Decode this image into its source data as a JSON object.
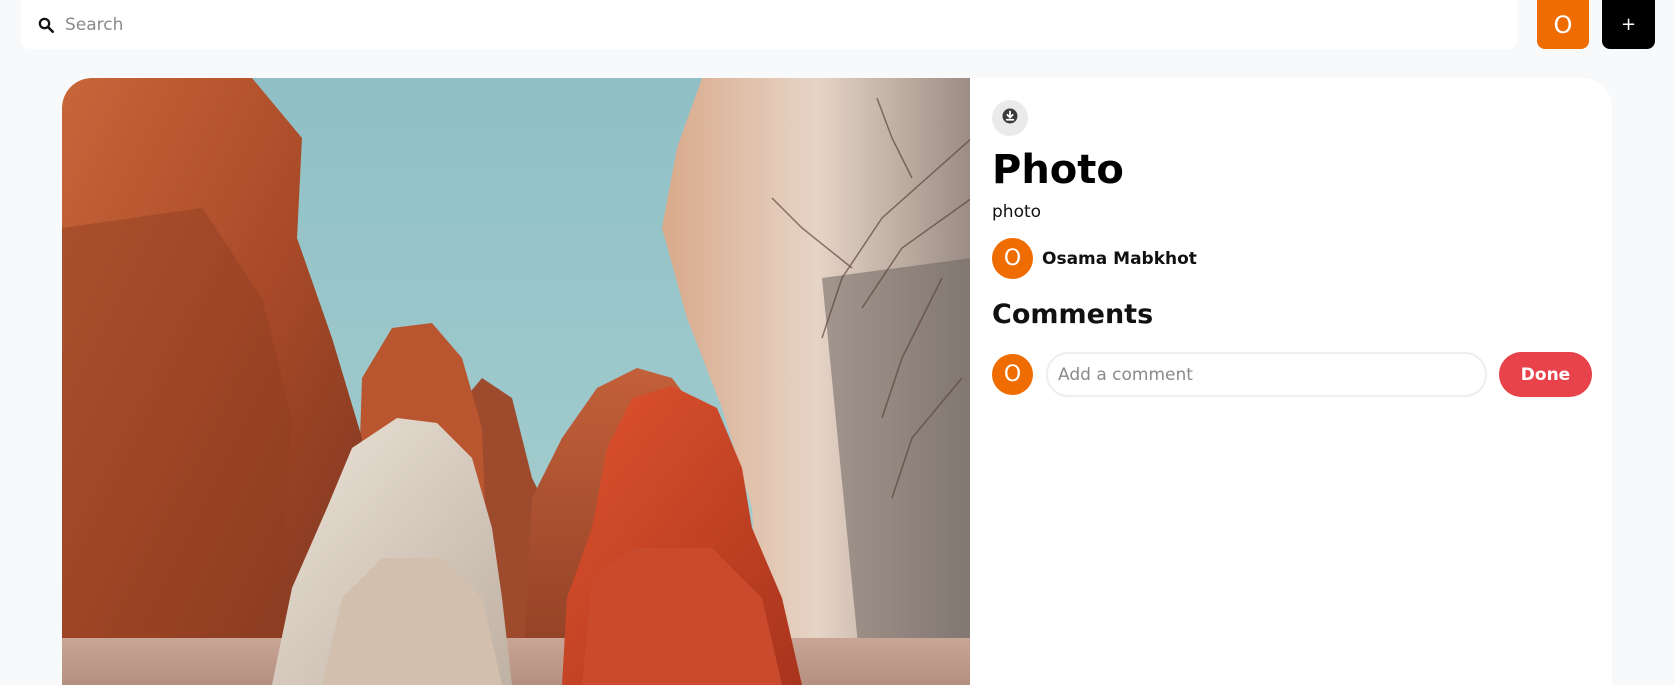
{
  "search": {
    "placeholder": "Search",
    "icon": "search-icon"
  },
  "header": {
    "user_initial": "O",
    "create_label": "+",
    "accent_color": "#ef6c00"
  },
  "pin": {
    "download_icon": "download-icon",
    "title": "Photo",
    "description": "photo",
    "image_alt": "Two women in headscarves facing red desert canyon cliffs"
  },
  "author": {
    "initial": "O",
    "name": "Osama Mabkhot"
  },
  "comments": {
    "heading": "Comments",
    "user_initial": "O",
    "placeholder": "Add a comment",
    "submit_label": "Done",
    "submit_color": "#e8434b"
  }
}
